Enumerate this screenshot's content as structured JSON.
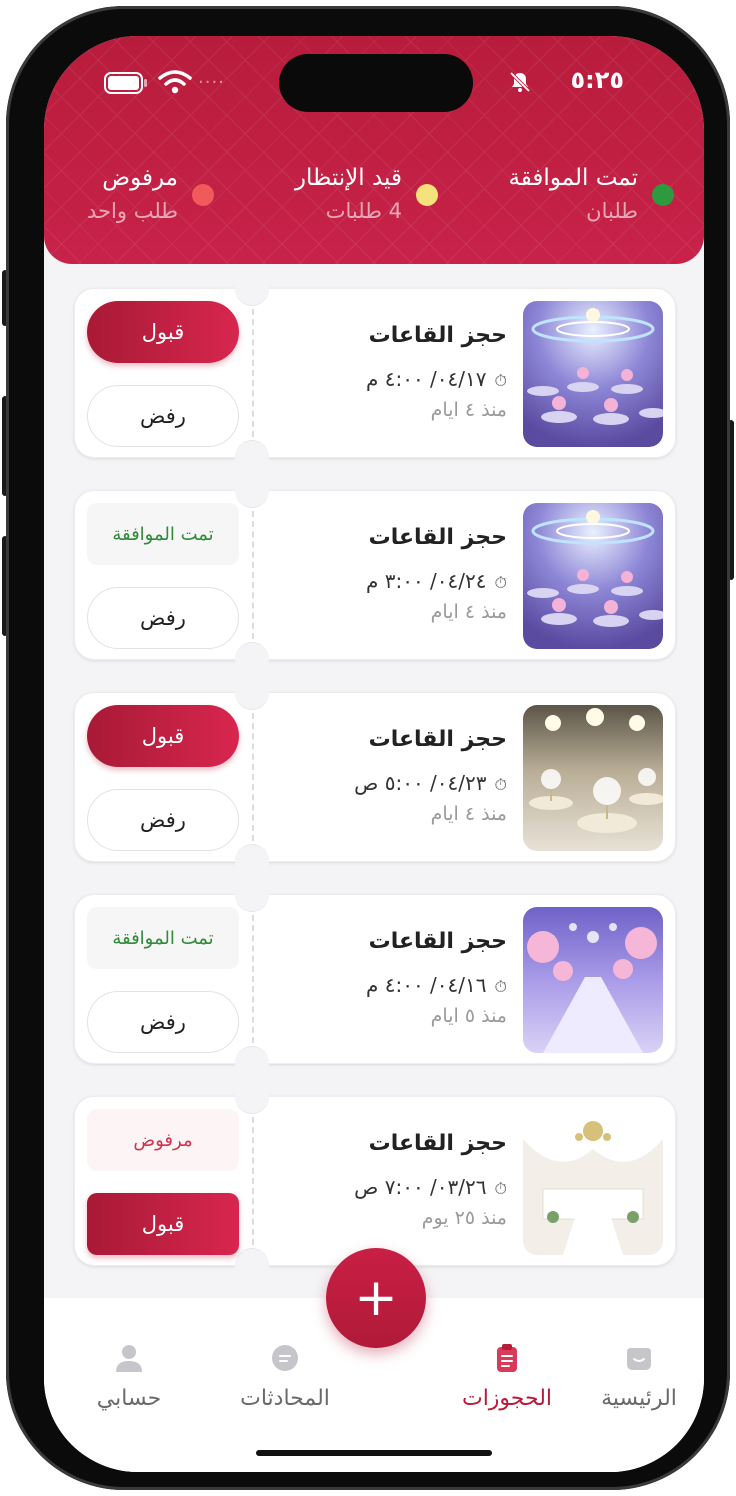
{
  "status_bar": {
    "time": "٥:٢٥",
    "signal_dots": "····"
  },
  "summary": {
    "approved": {
      "title": "تمت الموافقة",
      "subtitle": "طلبان",
      "color": "#2e9a3e"
    },
    "pending": {
      "title": "قيد الإنتظار",
      "subtitle": "4 طلبات",
      "color": "#f6e27a"
    },
    "rejected": {
      "title": "مرفوض",
      "subtitle": "طلب واحد",
      "color": "#f05a5a"
    }
  },
  "bookings": [
    {
      "title": "حجز القاعات",
      "date": "٠٤/١٧/ ٤:٠٠ م",
      "ago": "منذ ٤ ايام",
      "status_label": "",
      "primary": "قبول",
      "secondary": "رفض"
    },
    {
      "title": "حجز القاعات",
      "date": "٠٤/٢٤/ ٣:٠٠ م",
      "ago": "منذ ٤ ايام",
      "status_label": "تمت الموافقة",
      "primary": "",
      "secondary": "رفض"
    },
    {
      "title": "حجز القاعات",
      "date": "٠٤/٢٣/ ٥:٠٠ ص",
      "ago": "منذ ٤ ايام",
      "status_label": "",
      "primary": "قبول",
      "secondary": "رفض"
    },
    {
      "title": "حجز القاعات",
      "date": "٠٤/١٦/ ٤:٠٠ م",
      "ago": "منذ ٥ ايام",
      "status_label": "تمت الموافقة",
      "primary": "",
      "secondary": "رفض"
    },
    {
      "title": "حجز القاعات",
      "date": "٠٣/٢٦/ ٧:٠٠ ص",
      "ago": "منذ ٢٥ يوم",
      "status_label": "مرفوض",
      "primary": "قبول",
      "secondary": ""
    }
  ],
  "fab": {
    "label": "+"
  },
  "tabs": {
    "home": "الرئيسية",
    "bookings": "الحجوزات",
    "chats": "المحادثات",
    "account": "حسابي"
  },
  "colors": {
    "brand": "#b81c3b",
    "approved_text": "#2e8b3a",
    "rejected_text": "#d0344f"
  }
}
